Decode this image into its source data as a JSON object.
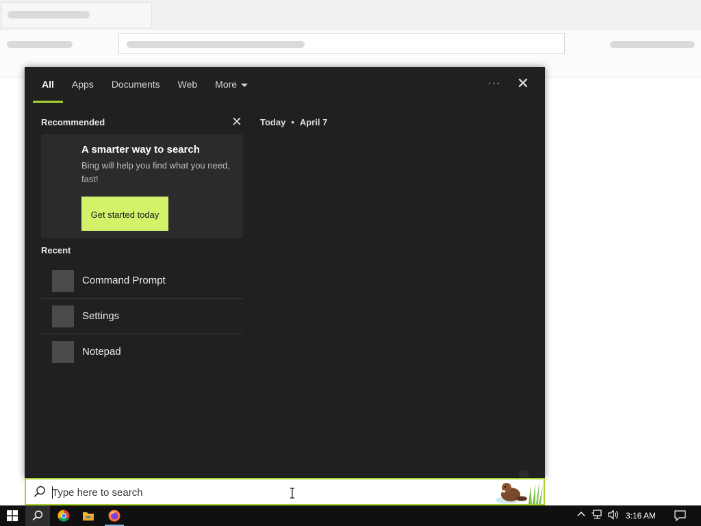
{
  "search_panel": {
    "tabs": [
      {
        "label": "All",
        "active": true
      },
      {
        "label": "Apps",
        "active": false
      },
      {
        "label": "Documents",
        "active": false
      },
      {
        "label": "Web",
        "active": false
      },
      {
        "label": "More",
        "active": false
      }
    ],
    "more_options_label": "···",
    "close_label": "✕",
    "recommended": {
      "title": "Recommended",
      "dismiss_label": "✕",
      "card": {
        "title": "A smarter way to search",
        "description": "Bing will help you find what you need, fast!",
        "button_label": "Get started today"
      }
    },
    "recent": {
      "title": "Recent",
      "items": [
        {
          "label": "Command Prompt"
        },
        {
          "label": "Settings"
        },
        {
          "label": "Notepad"
        }
      ]
    },
    "today": {
      "label": "Today",
      "separator": "•",
      "date": "April 7"
    }
  },
  "search_box": {
    "placeholder": "Type here to search",
    "value": ""
  },
  "taskbar": {
    "apps": [
      "start-icon",
      "search-icon",
      "chrome-icon",
      "file-explorer-icon",
      "firefox-icon"
    ],
    "clock": "3:16 AM"
  },
  "colors": {
    "accent": "#a8d32e",
    "button": "#d3f26a",
    "panel_bg": "#202020",
    "taskbar_bg": "#101010"
  }
}
